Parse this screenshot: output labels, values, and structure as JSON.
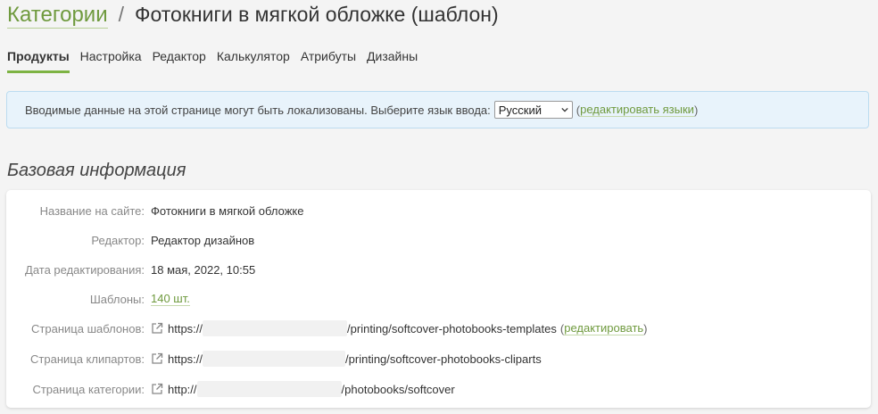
{
  "breadcrumb": {
    "root": "Категории",
    "separator": "/",
    "current": "Фотокниги в мягкой обложке (шаблон)"
  },
  "tabs": [
    {
      "label": "Продукты",
      "active": true
    },
    {
      "label": "Настройка"
    },
    {
      "label": "Редактор"
    },
    {
      "label": "Калькулятор"
    },
    {
      "label": "Атрибуты"
    },
    {
      "label": "Дизайны"
    }
  ],
  "notice": {
    "text": "Вводимые данные на этой странице могут быть локализованы. Выберите язык ввода:",
    "language": "Русский",
    "paren_open": "(",
    "edit_link": "редактировать языки",
    "paren_close": ")"
  },
  "section_title": "Базовая информация",
  "info": {
    "site_name": {
      "label": "Название на сайте:",
      "value": "Фотокниги в мягкой обложке"
    },
    "editor": {
      "label": "Редактор:",
      "value": "Редактор дизайнов"
    },
    "edit_date": {
      "label": "Дата редактирования:",
      "value": "18 мая, 2022, 10:55"
    },
    "templates": {
      "label": "Шаблоны:",
      "value": "140 шт."
    },
    "templates_page": {
      "label": "Страница шаблонов:",
      "prefix": "https://",
      "suffix": "/printing/softcover-photobooks-templates",
      "edit_open": "(",
      "edit_link": "редактировать",
      "edit_close": ")"
    },
    "cliparts_page": {
      "label": "Страница клипартов:",
      "prefix": "https://",
      "suffix": "/printing/softcover-photobooks-cliparts"
    },
    "category_page": {
      "label": "Страница категории:",
      "prefix": "http://",
      "suffix": "/photobooks/softcover"
    }
  },
  "colors": {
    "accent": "#6f9a3e",
    "tab_underline": "#7db343",
    "notice_bg": "#e8f3fb"
  }
}
